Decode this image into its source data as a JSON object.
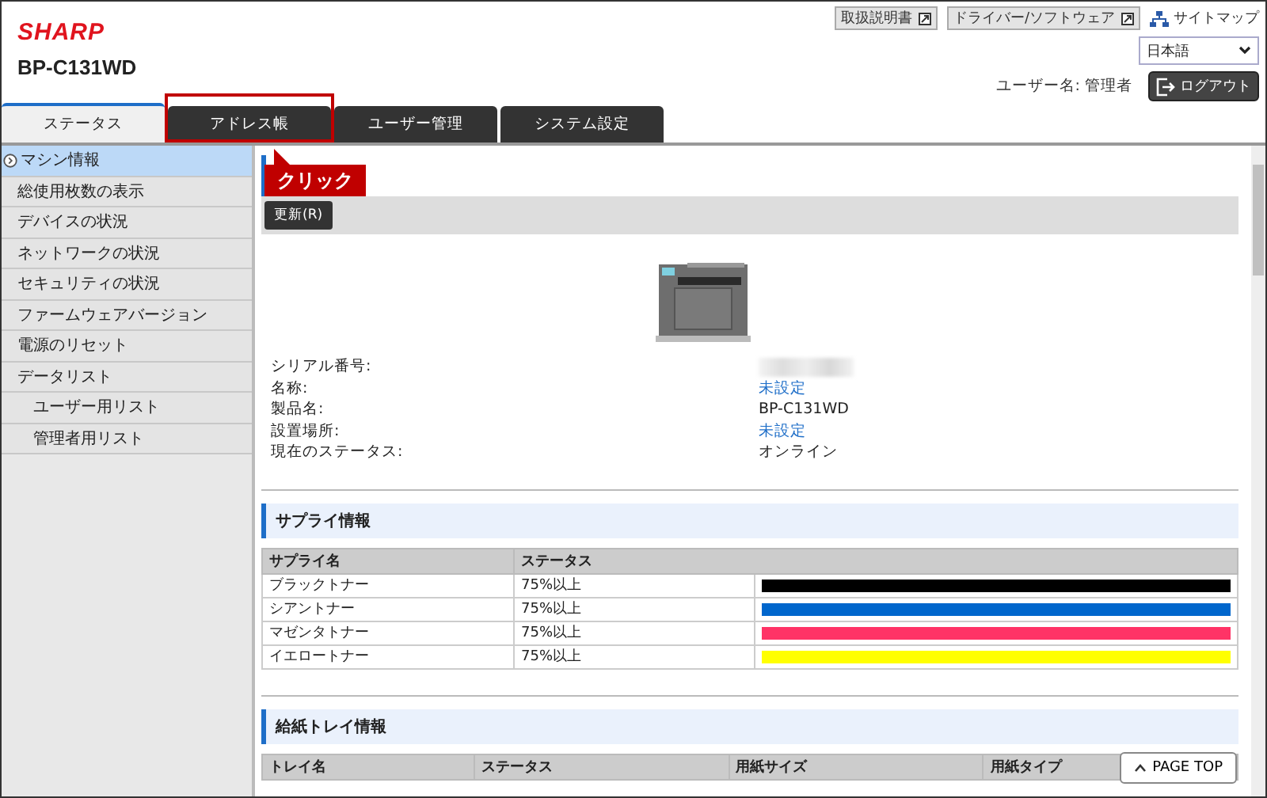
{
  "header": {
    "logo": "SHARP",
    "model": "BP-C131WD",
    "links": [
      {
        "label": "取扱説明書",
        "kind": "external"
      },
      {
        "label": "ドライバー/ソフトウェア",
        "kind": "external"
      },
      {
        "label": "サイトマップ",
        "kind": "sitemap"
      }
    ],
    "language": "日本語",
    "user_label": "ユーザー名: 管理者",
    "logout": "ログアウト"
  },
  "tabs": [
    {
      "label": "ステータス",
      "selected": true
    },
    {
      "label": "アドレス帳",
      "selected": false
    },
    {
      "label": "ユーザー管理",
      "selected": false
    },
    {
      "label": "システム設定",
      "selected": false
    }
  ],
  "callout": {
    "label": "クリック"
  },
  "sidebar": {
    "items": [
      {
        "label": "マシン情報",
        "selected": true
      },
      {
        "label": "総使用枚数の表示",
        "selected": false
      },
      {
        "label": "デバイスの状況",
        "selected": false
      },
      {
        "label": "ネットワークの状況",
        "selected": false
      },
      {
        "label": "セキュリティの状況",
        "selected": false
      },
      {
        "label": "ファームウェアバージョン",
        "selected": false
      },
      {
        "label": "電源のリセット",
        "selected": false
      },
      {
        "label": "データリスト",
        "selected": false,
        "children": [
          {
            "label": "ユーザー用リスト",
            "selected": false
          },
          {
            "label": "管理者用リスト",
            "selected": false
          }
        ]
      }
    ]
  },
  "refresh_button": "更新(R)",
  "machine_info": [
    {
      "label": "シリアル番号:",
      "kind": "hidden"
    },
    {
      "label": "名称:",
      "value": "未設定",
      "kind": "link"
    },
    {
      "label": "製品名:",
      "value": "BP-C131WD",
      "kind": "text"
    },
    {
      "label": "設置場所:",
      "value": "未設定",
      "kind": "link"
    },
    {
      "label": "現在のステータス:",
      "value": "オンライン",
      "kind": "text"
    }
  ],
  "supply": {
    "title": "サプライ情報",
    "columns": [
      "サプライ名",
      "ステータス"
    ],
    "rows": [
      {
        "name": "ブラックトナー",
        "status": "75%以上",
        "level": 1,
        "color": "#000000"
      },
      {
        "name": "シアントナー",
        "status": "75%以上",
        "level": 1,
        "color": "#0066cc"
      },
      {
        "name": "マゼンタトナー",
        "status": "75%以上",
        "level": 1,
        "color": "#ff3366"
      },
      {
        "name": "イエロートナー",
        "status": "75%以上",
        "level": 1,
        "color": "#ffff00"
      }
    ]
  },
  "tray": {
    "title": "給紙トレイ情報",
    "columns": [
      "トレイ名",
      "ステータス",
      "用紙サイズ",
      "用紙タイプ"
    ]
  },
  "page_top": "PAGE TOP"
}
